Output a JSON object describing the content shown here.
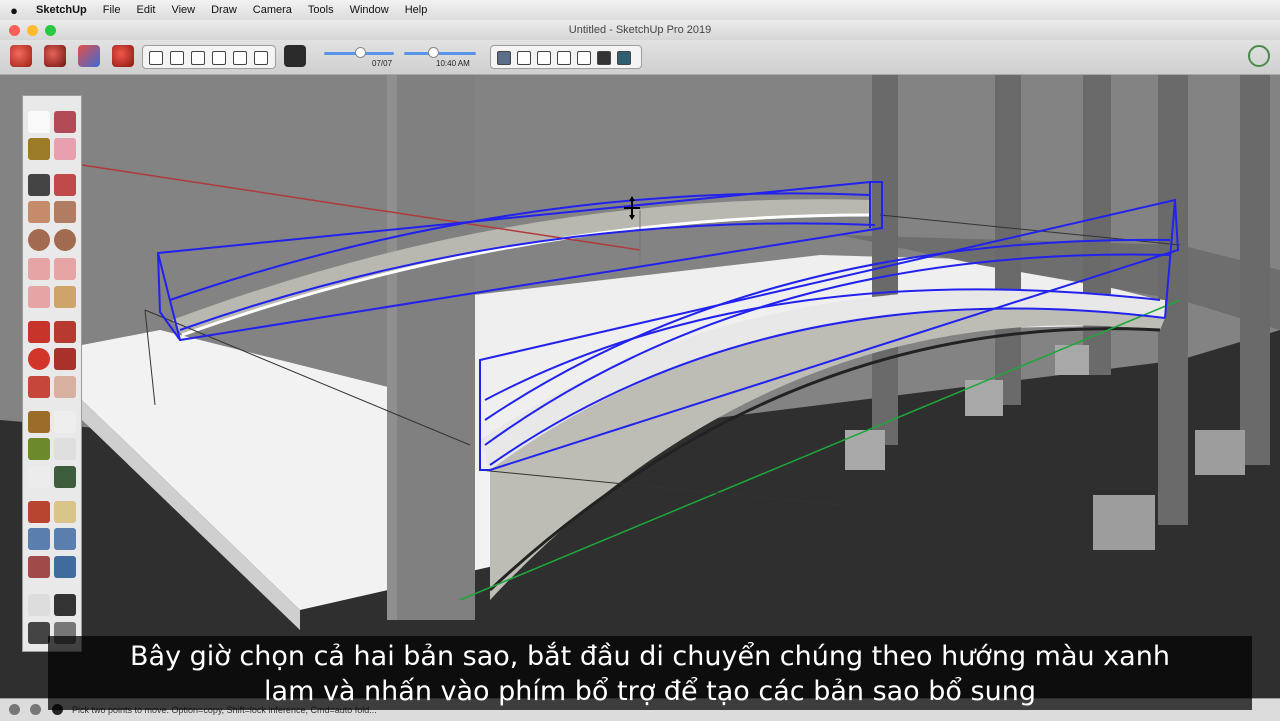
{
  "menubar": {
    "app_name": "SketchUp",
    "items": [
      "File",
      "Edit",
      "View",
      "Draw",
      "Camera",
      "Tools",
      "Window",
      "Help"
    ]
  },
  "window": {
    "title": "Untitled - SketchUp Pro 2019"
  },
  "toolbar": {
    "shadow_time_label": "07/07",
    "shadow_hour_label": "10:40 AM"
  },
  "status_bar": {
    "text": "Pick two points to move. Option=copy, Shift=lock inference, Cmd=auto fold..."
  },
  "subtitle": {
    "line1": "Bây giờ chọn cả hai bản sao, bắt đầu di chuyển chúng theo hướng màu xanh",
    "line2": "lam và nhấn vào phím bổ trợ để tạo các bản sao bổ sung"
  },
  "colors": {
    "selection": "#2222ee",
    "red_axis": "#b03a3a",
    "green_axis": "#1fa53a",
    "sky": "#838383",
    "ground": "#2f2f2f"
  }
}
